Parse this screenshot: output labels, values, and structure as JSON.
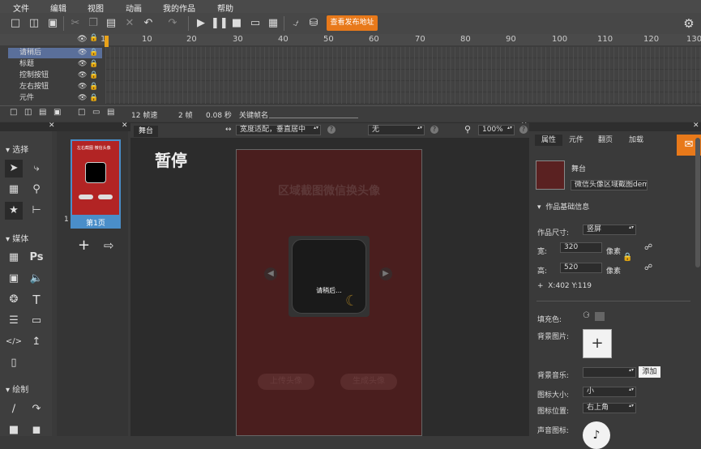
{
  "menu": [
    "文件",
    "编辑",
    "视图",
    "动画",
    "我的作品",
    "帮助"
  ],
  "toolbar": {
    "publish_label": "查看发布地址"
  },
  "timeline": {
    "ticks": [
      "1",
      "10",
      "20",
      "30",
      "40",
      "50",
      "60",
      "70",
      "80",
      "90",
      "100",
      "110",
      "120",
      "130"
    ],
    "layers": [
      "请稍后",
      "标题",
      "控制按钮",
      "左右按钮",
      "元件"
    ],
    "fps": "12 帧速",
    "frames": "2 帧",
    "seconds": "0.08 秒",
    "keyframe_label": "关键帧名"
  },
  "left_tools": {
    "select": "选择",
    "media": "媒体",
    "draw": "绘制"
  },
  "pages": {
    "page_number": "1",
    "page_label": "第1页",
    "thumb_title": "左右截图 微信头像"
  },
  "stage": {
    "tab": "舞台",
    "fit_select": "宽度适配，垂直居中",
    "effect_select": "无",
    "zoom": "100%",
    "pause_label": "暂停",
    "phone_title": "区域截图微信换头像",
    "loading": "请稍后...",
    "btn_upload": "上传头像",
    "btn_generate": "生成头像"
  },
  "right": {
    "tabs": [
      "属性",
      "元件",
      "翻页",
      "加载"
    ],
    "stage_label": "舞台",
    "work_name": "微信头像区域截图demo",
    "basic_info": "作品基础信息",
    "size_label": "作品尺寸:",
    "size_value": "竖屏",
    "width_label": "宽:",
    "width_value": "320",
    "height_label": "高:",
    "height_value": "520",
    "unit": "像素",
    "coords": "X:402    Y:119",
    "fill_label": "填充色:",
    "bgimg_label": "背景图片:",
    "bgmusic_label": "背景音乐:",
    "add_label": "添加",
    "iconsize_label": "图标大小:",
    "iconsize_value": "小",
    "iconpos_label": "图标位置:",
    "iconpos_value": "右上角",
    "soundicon_label": "声音图标:"
  },
  "colors": {
    "accent": "#e8791a",
    "selection": "#5a6f9a",
    "phone_bg": "#5a2121"
  }
}
